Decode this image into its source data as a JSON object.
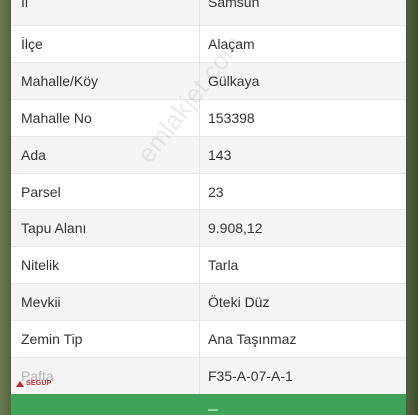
{
  "rows": [
    {
      "key": "İl",
      "value": "Samsun"
    },
    {
      "key": "İlçe",
      "value": "Alaçam"
    },
    {
      "key": "Mahalle/Köy",
      "value": "Gülkaya"
    },
    {
      "key": "Mahalle No",
      "value": "153398"
    },
    {
      "key": "Ada",
      "value": "143"
    },
    {
      "key": "Parsel",
      "value": "23"
    },
    {
      "key": "Tapu Alanı",
      "value": "9.908,12"
    },
    {
      "key": "Nitelik",
      "value": "Tarla"
    },
    {
      "key": "Mevkii",
      "value": "Öteki Düz"
    },
    {
      "key": "Zemin Tip",
      "value": "Ana Taşınmaz"
    },
    {
      "key": "Pafta",
      "value": "F35-A-07-A-1"
    }
  ],
  "watermark": "emlakjet.com",
  "logo": "SEGUP",
  "colors": {
    "accent_green": "#3fa45a",
    "row_alt": "#f5f5f5",
    "logo_red": "#c22a2a"
  }
}
